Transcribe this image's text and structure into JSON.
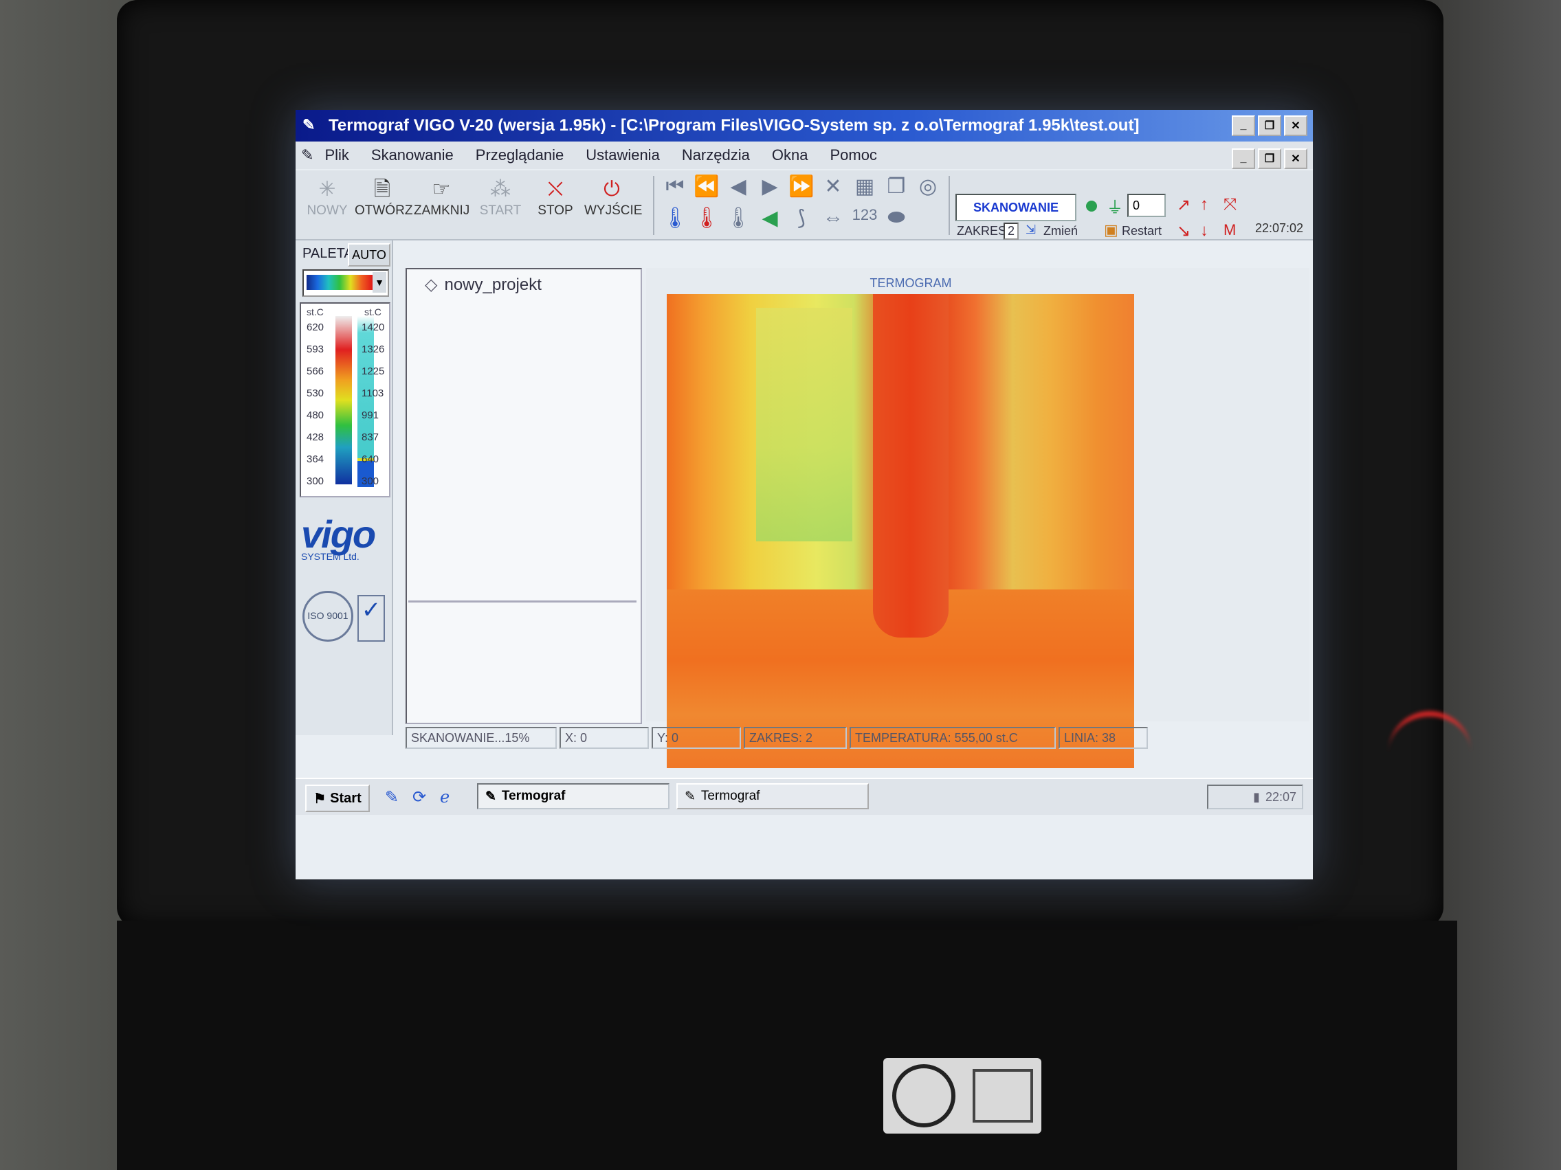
{
  "window": {
    "title": "Termograf VIGO V-20 (wersja 1.95k) - [C:\\Program Files\\VIGO-System sp. z o.o\\Termograf 1.95k\\test.out]"
  },
  "menu": [
    "Plik",
    "Skanowanie",
    "Przeglądanie",
    "Ustawienia",
    "Narzędzia",
    "Okna",
    "Pomoc"
  ],
  "toolbar": {
    "nowy": "NOWY",
    "otworz": "OTWÓRZ",
    "zamknij": "ZAMKNIJ",
    "start": "START",
    "stop": "STOP",
    "wyjscie": "WYJŚCIE",
    "scan_label": "SKANOWANIE",
    "counter": "0",
    "zakres_label": "ZAKRES",
    "zakres_value": "2",
    "zmien": "Zmień",
    "restart": "Restart",
    "clock": "22:07:02"
  },
  "palette": {
    "label": "PALETA:",
    "auto": "AUTO",
    "unit": "st.C",
    "left_scale": [
      "620",
      "593",
      "566",
      "530",
      "480",
      "428",
      "364",
      "300"
    ],
    "right_scale": [
      "1420",
      "1326",
      "1225",
      "1103",
      "991",
      "837",
      "640",
      "300"
    ]
  },
  "logo": {
    "brand": "vigo",
    "sub": "SYSTEM Ltd.",
    "iso": "ISO 9001"
  },
  "project": {
    "name": "nowy_projekt"
  },
  "termogram": {
    "title": "TERMOGRAM"
  },
  "status": {
    "scan": "SKANOWANIE...15%",
    "x": "X: 0",
    "y": "Y: 0",
    "zakres": "ZAKRES: 2",
    "temp": "TEMPERATURA: 555,00 st.C",
    "linia": "LINIA: 38"
  },
  "taskbar": {
    "start": "Start",
    "task1": "Termograf",
    "task2": "Termograf",
    "time": "22:07"
  }
}
